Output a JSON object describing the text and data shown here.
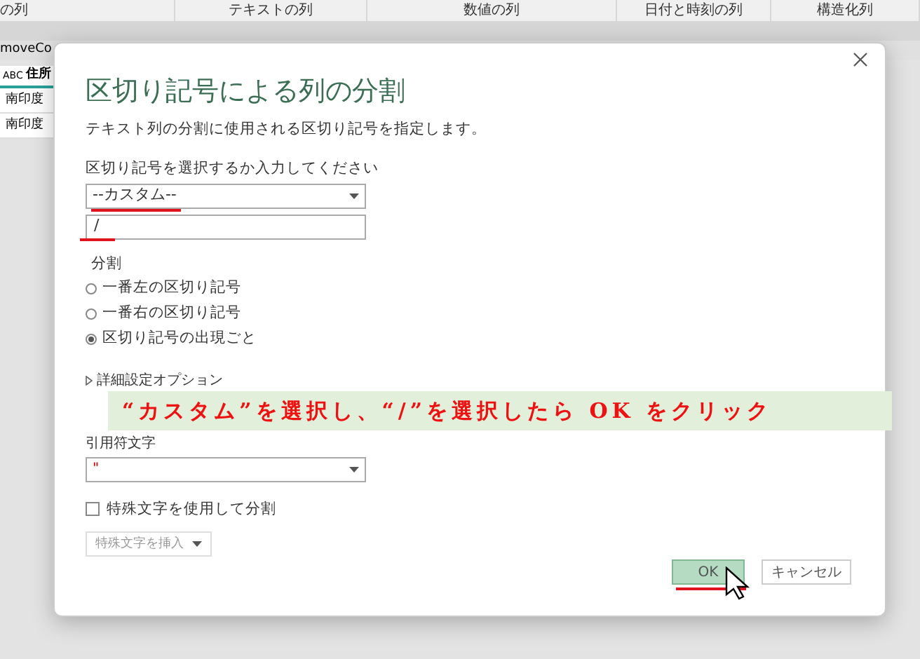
{
  "ribbon": {
    "columns": [
      "の列",
      "テキストの列",
      "数値の列",
      "日付と時刻の列",
      "構造化列"
    ]
  },
  "formula_bar": {
    "text": "moveCo"
  },
  "table": {
    "column_header": {
      "type_icon": "ABC",
      "label": "住所"
    },
    "rows": [
      "南印度",
      "南印度"
    ]
  },
  "dialog": {
    "title": "区切り記号による列の分割",
    "description": "テキスト列の分割に使用される区切り記号を指定します。",
    "delimiter_label": "区切り記号を選択するか入力してください",
    "delimiter_select": {
      "value": "--カスタム--",
      "underlined": true
    },
    "delimiter_input": {
      "value": "/",
      "underlined": true
    },
    "split_label": "分割",
    "split_options": [
      {
        "label": "一番左の区切り記号",
        "selected": false
      },
      {
        "label": "一番右の区切り記号",
        "selected": false
      },
      {
        "label": "区切り記号の出現ごと",
        "selected": true
      }
    ],
    "advanced": {
      "label": "詳細設定オプション",
      "expanded": false
    },
    "quote_label": "引用符文字",
    "quote_select": {
      "value": "\""
    },
    "special_chars": {
      "label": "特殊文字を使用して分割",
      "checked": false
    },
    "insert_button": {
      "label": "特殊文字を挿入",
      "disabled": true
    },
    "buttons": [
      {
        "kind": "primary",
        "label": "OK",
        "underlined": true
      },
      {
        "kind": "secondary",
        "label": "キャンセル"
      }
    ]
  },
  "callout": {
    "text": "“カスタム”を選択し、“/”を選択したら OK をクリック"
  }
}
